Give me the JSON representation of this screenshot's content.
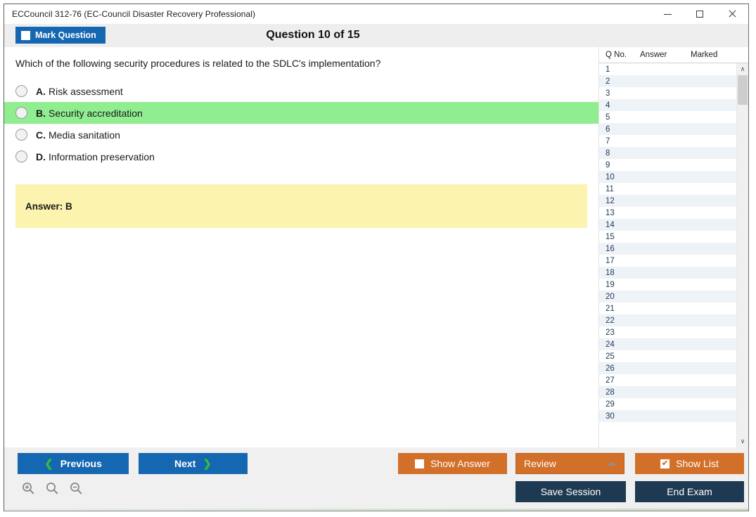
{
  "window": {
    "title": "ECCouncil 312-76 (EC-Council Disaster Recovery Professional)",
    "minimize_label": "Minimize",
    "maximize_label": "Maximize",
    "close_label": "Close"
  },
  "toolbar": {
    "mark_question_label": "Mark Question",
    "mark_question_checked": false,
    "question_counter": "Question 10 of 15"
  },
  "question": {
    "text": "Which of the following security procedures is related to the SDLC's implementation?",
    "options": [
      {
        "letter": "A.",
        "text": "Risk assessment",
        "highlighted": false
      },
      {
        "letter": "B.",
        "text": "Security accreditation",
        "highlighted": true
      },
      {
        "letter": "C.",
        "text": "Media sanitation",
        "highlighted": false
      },
      {
        "letter": "D.",
        "text": "Information preservation",
        "highlighted": false
      }
    ],
    "answer_label": "Answer: B"
  },
  "list_panel": {
    "columns": [
      "Q No.",
      "Answer",
      "Marked"
    ],
    "rows": [
      {
        "qno": "1",
        "answer": "",
        "marked": ""
      },
      {
        "qno": "2",
        "answer": "",
        "marked": ""
      },
      {
        "qno": "3",
        "answer": "",
        "marked": ""
      },
      {
        "qno": "4",
        "answer": "",
        "marked": ""
      },
      {
        "qno": "5",
        "answer": "",
        "marked": ""
      },
      {
        "qno": "6",
        "answer": "",
        "marked": ""
      },
      {
        "qno": "7",
        "answer": "",
        "marked": ""
      },
      {
        "qno": "8",
        "answer": "",
        "marked": ""
      },
      {
        "qno": "9",
        "answer": "",
        "marked": ""
      },
      {
        "qno": "10",
        "answer": "",
        "marked": ""
      },
      {
        "qno": "11",
        "answer": "",
        "marked": ""
      },
      {
        "qno": "12",
        "answer": "",
        "marked": ""
      },
      {
        "qno": "13",
        "answer": "",
        "marked": ""
      },
      {
        "qno": "14",
        "answer": "",
        "marked": ""
      },
      {
        "qno": "15",
        "answer": "",
        "marked": ""
      },
      {
        "qno": "16",
        "answer": "",
        "marked": ""
      },
      {
        "qno": "17",
        "answer": "",
        "marked": ""
      },
      {
        "qno": "18",
        "answer": "",
        "marked": ""
      },
      {
        "qno": "19",
        "answer": "",
        "marked": ""
      },
      {
        "qno": "20",
        "answer": "",
        "marked": ""
      },
      {
        "qno": "21",
        "answer": "",
        "marked": ""
      },
      {
        "qno": "22",
        "answer": "",
        "marked": ""
      },
      {
        "qno": "23",
        "answer": "",
        "marked": ""
      },
      {
        "qno": "24",
        "answer": "",
        "marked": ""
      },
      {
        "qno": "25",
        "answer": "",
        "marked": ""
      },
      {
        "qno": "26",
        "answer": "",
        "marked": ""
      },
      {
        "qno": "27",
        "answer": "",
        "marked": ""
      },
      {
        "qno": "28",
        "answer": "",
        "marked": ""
      },
      {
        "qno": "29",
        "answer": "",
        "marked": ""
      },
      {
        "qno": "30",
        "answer": "",
        "marked": ""
      }
    ],
    "scroll_up_glyph": "∧",
    "scroll_down_glyph": "∨"
  },
  "footer": {
    "previous_label": "Previous",
    "next_label": "Next",
    "prev_chevron": "❮",
    "next_chevron": "❯",
    "show_answer_label": "Show Answer",
    "show_answer_checked": false,
    "review_label": "Review",
    "show_list_label": "Show List",
    "show_list_checked": true,
    "show_list_check_glyph": "✔",
    "save_session_label": "Save Session",
    "end_exam_label": "End Exam",
    "zoom_in_name": "zoom-in",
    "zoom_reset_name": "zoom-reset",
    "zoom_out_name": "zoom-out"
  },
  "colors": {
    "accent_blue": "#1667b1",
    "accent_orange": "#d2702a",
    "dark_navy": "#1e3a52",
    "highlight_green": "#90ee90",
    "answer_yellow": "#fbf3ae",
    "chevron_green": "#2fbf3a"
  }
}
